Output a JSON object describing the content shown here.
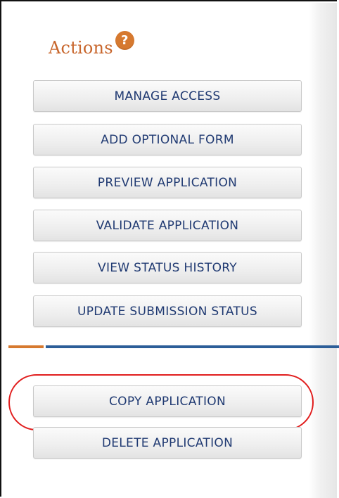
{
  "panel": {
    "title": "Actions",
    "help_icon_glyph": "?"
  },
  "buttons": {
    "manage_access": "MANAGE ACCESS",
    "add_optional_form": "ADD OPTIONAL FORM",
    "preview_application": "PREVIEW APPLICATION",
    "validate_application": "VALIDATE APPLICATION",
    "view_status_history": "VIEW STATUS HISTORY",
    "update_submission_status": "UPDATE SUBMISSION STATUS",
    "copy_application": "COPY APPLICATION",
    "delete_application": "DELETE APPLICATION"
  },
  "colors": {
    "accent_orange": "#c8662c",
    "divider_blue": "#2c5e98",
    "button_text": "#203a72",
    "highlight_red": "#e11d1d"
  },
  "highlight": {
    "target": "copy_application",
    "shape": "red ellipse annotation"
  }
}
